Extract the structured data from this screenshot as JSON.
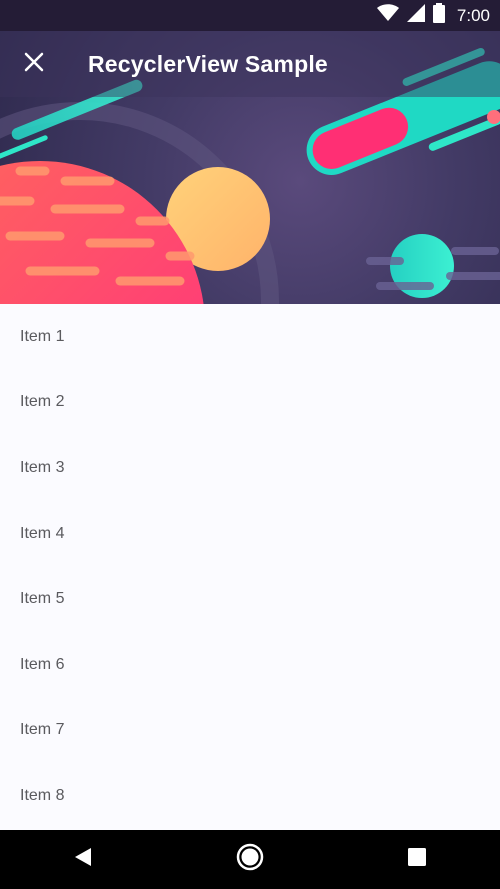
{
  "status_bar": {
    "time": "7:00"
  },
  "app_bar": {
    "title": "RecyclerView Sample"
  },
  "list": {
    "items": [
      {
        "label": "Item 1"
      },
      {
        "label": "Item 2"
      },
      {
        "label": "Item 3"
      },
      {
        "label": "Item 4"
      },
      {
        "label": "Item 5"
      },
      {
        "label": "Item 6"
      },
      {
        "label": "Item 7"
      },
      {
        "label": "Item 8"
      }
    ]
  },
  "icons": {
    "close": "close-icon",
    "wifi": "wifi-icon",
    "signal": "signal-icon",
    "battery": "battery-icon",
    "back": "back-icon",
    "home": "home-icon",
    "recents": "recents-icon"
  },
  "colors": {
    "status_bar": "#241c36",
    "hero_bg": "#433b66",
    "list_bg": "#fbfbff",
    "nav_bar": "#000000",
    "planet_pink": "#ff3f7a",
    "planet_yellow": "#ffc36a",
    "comet_teal": "#2ee6c8"
  }
}
